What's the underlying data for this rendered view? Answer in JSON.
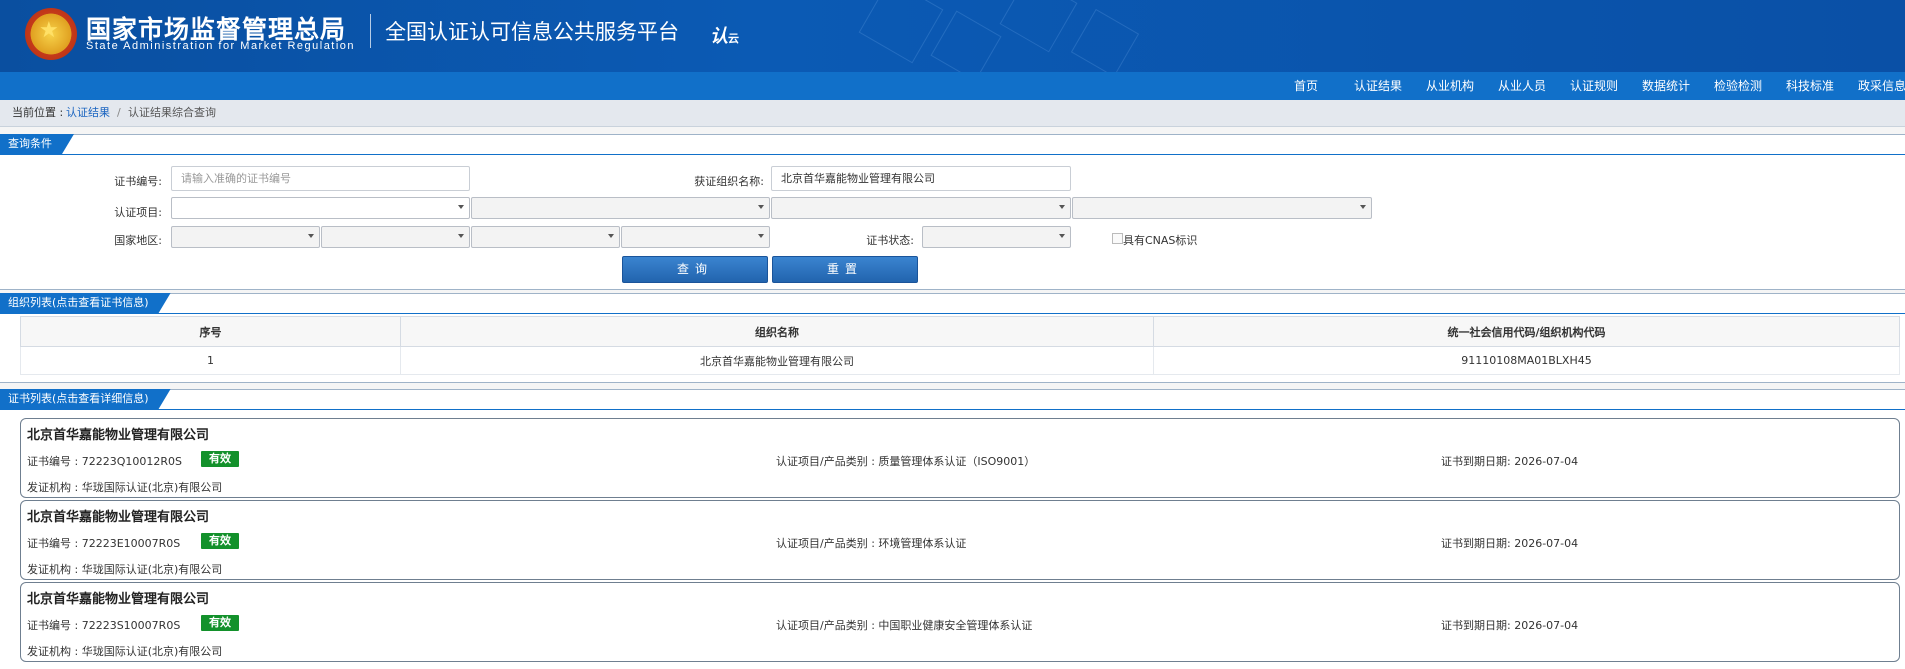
{
  "header": {
    "agency_cn": "国家市场监督管理总局",
    "agency_en": "State Administration  for  Market Regulation",
    "platform": "全国认证认可信息公共服务平台",
    "logo_mark": "认",
    "logo_mark_small": "云"
  },
  "nav": {
    "items": [
      "首页",
      "认证结果",
      "从业机构",
      "从业人员",
      "认证规则",
      "数据统计",
      "检验检测",
      "科技标准",
      "政采信息"
    ]
  },
  "breadcrumb": {
    "prefix": "当前位置 :",
    "link": "认证结果",
    "separator": "/",
    "current": "认证结果综合查询"
  },
  "query": {
    "title": "查询条件",
    "cert_no_label": "证书编号:",
    "cert_no_placeholder": "请输入准确的证书编号",
    "org_name_label": "获证组织名称:",
    "org_name_value": "北京首华嘉能物业管理有限公司",
    "cert_item_label": "认证项目:",
    "region_label": "国家地区:",
    "status_label": "证书状态:",
    "cnas_label": "具有CNAS标识",
    "search_button": "查询",
    "reset_button": "重置"
  },
  "org_list": {
    "title": "组织列表(点击查看证书信息)",
    "columns": [
      "序号",
      "组织名称",
      "统一社会信用代码/组织机构代码"
    ],
    "rows": [
      {
        "index": "1",
        "name": "北京首华嘉能物业管理有限公司",
        "code": "91110108MA01BLXH45"
      }
    ]
  },
  "cert_list": {
    "title": "证书列表(点击查看详细信息)",
    "cert_no_prefix": "证书编号 :",
    "item_prefix": "认证项目/产品类别 :",
    "expiry_prefix": "证书到期日期:",
    "issuer_prefix": "发证机构 :",
    "items": [
      {
        "org": "北京首华嘉能物业管理有限公司",
        "cert_no": "72223Q10012R0S",
        "status": "有效",
        "item": "质量管理体系认证（ISO9001）",
        "expiry": "2026-07-04",
        "issuer": "华珑国际认证(北京)有限公司"
      },
      {
        "org": "北京首华嘉能物业管理有限公司",
        "cert_no": "72223E10007R0S",
        "status": "有效",
        "item": "环境管理体系认证",
        "expiry": "2026-07-04",
        "issuer": "华珑国际认证(北京)有限公司"
      },
      {
        "org": "北京首华嘉能物业管理有限公司",
        "cert_no": "72223S10007R0S",
        "status": "有效",
        "item": "中国职业健康安全管理体系认证",
        "expiry": "2026-07-04",
        "issuer": "华珑国际认证(北京)有限公司"
      }
    ]
  }
}
